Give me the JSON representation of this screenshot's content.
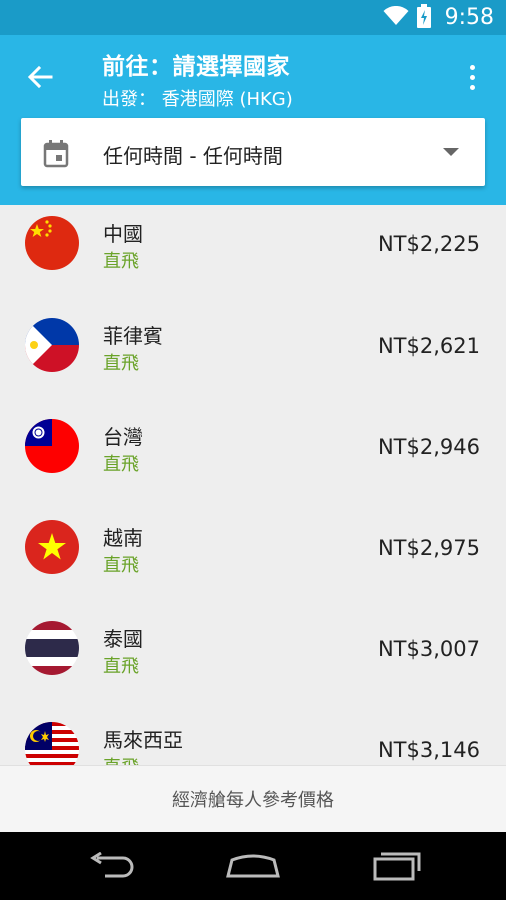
{
  "status_bar": {
    "time": "9:58"
  },
  "header": {
    "title": "前往：請選擇國家",
    "subtitle": "出發： 香港國際 (HKG)"
  },
  "date_selector": {
    "value": "任何時間 - 任何時間"
  },
  "destinations": [
    {
      "country": "中國",
      "tag": "直飛",
      "price": "NT$2,225",
      "flag": "china-flag-icon"
    },
    {
      "country": "菲律賓",
      "tag": "直飛",
      "price": "NT$2,621",
      "flag": "philippines-flag-icon"
    },
    {
      "country": "台灣",
      "tag": "直飛",
      "price": "NT$2,946",
      "flag": "taiwan-flag-icon"
    },
    {
      "country": "越南",
      "tag": "直飛",
      "price": "NT$2,975",
      "flag": "vietnam-flag-icon"
    },
    {
      "country": "泰國",
      "tag": "直飛",
      "price": "NT$3,007",
      "flag": "thailand-flag-icon"
    },
    {
      "country": "馬來西亞",
      "tag": "直飛",
      "price": "NT$3,146",
      "flag": "malaysia-flag-icon"
    }
  ],
  "footer": {
    "note": "經濟艙每人參考價格"
  },
  "colors": {
    "status_bar": "#1a9bc8",
    "app_bar": "#29b6e6",
    "tag": "#6aa329",
    "list_bg": "#eeeeee"
  }
}
